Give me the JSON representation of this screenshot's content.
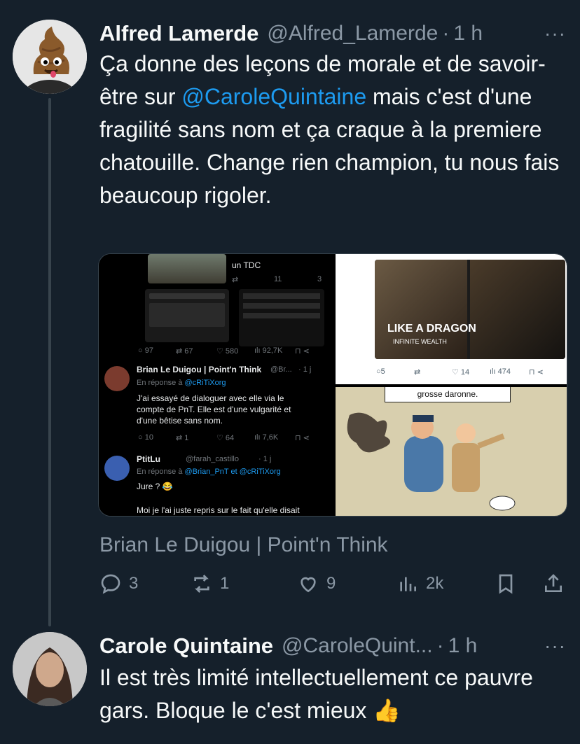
{
  "tweet1": {
    "name": "Alfred Lamerde",
    "handle": "@Alfred_Lamerde",
    "dot": "·",
    "time": "1 h",
    "more": "···",
    "text_before": "Ça donne des leçons de morale et de savoir-être sur ",
    "mention": "@CaroleQuintaine",
    "text_after": " mais c'est d'une fragilité sans nom et ça craque à la premiere chatouille. Change rien champion, tu nous fais beaucoup rigoler.",
    "media_caption": "Brian Le Duigou | Point'n Think",
    "actions": {
      "reply": "3",
      "retweet": "1",
      "like": "9",
      "views": "2k"
    }
  },
  "embedded": {
    "top_text": "un TDC",
    "top_stats": [
      "11",
      "3"
    ],
    "row1_stats": [
      "97",
      "67",
      "580",
      "92,7K"
    ],
    "reply1": {
      "name": "Brian Le Duigou | Point'n Think",
      "handle": "@Br...",
      "time": "· 1 j",
      "reply_to_prefix": "En réponse à ",
      "reply_to": "@cRiTiXorg",
      "text": [
        "J'ai essayé de dialoguer avec elle via le",
        "compte de PnT. Elle est d'une vulgarité et",
        "d'une bêtise sans nom."
      ],
      "stats": [
        "10",
        "1",
        "64",
        "7,6K"
      ]
    },
    "reply2": {
      "name": "PtitLu",
      "handle": "@farah_castillo",
      "time": "· 1 j",
      "reply_to_prefix": "En réponse à ",
      "reply_to": "@Brian_PnT et @cRiTiXorg",
      "text1": "Jure ? 😂",
      "text2": "Moi je l'ai juste repris sur le fait qu'elle disait"
    },
    "game_stats": [
      "5",
      "14",
      "474"
    ],
    "game_title": "LIKE A DRAGON",
    "game_sub": "INFINITE WEALTH",
    "comic_caption": "grosse daronne."
  },
  "tweet2": {
    "name": "Carole Quintaine",
    "handle": "@CaroleQuint...",
    "dot": "·",
    "time": "1 h",
    "more": "···",
    "text": "Il est très limité intellectuellement ce pauvre gars. Bloque le c'est mieux 👍"
  },
  "colors": {
    "background": "#15202b",
    "accent": "#1d9bf0",
    "muted": "#8b98a5"
  }
}
